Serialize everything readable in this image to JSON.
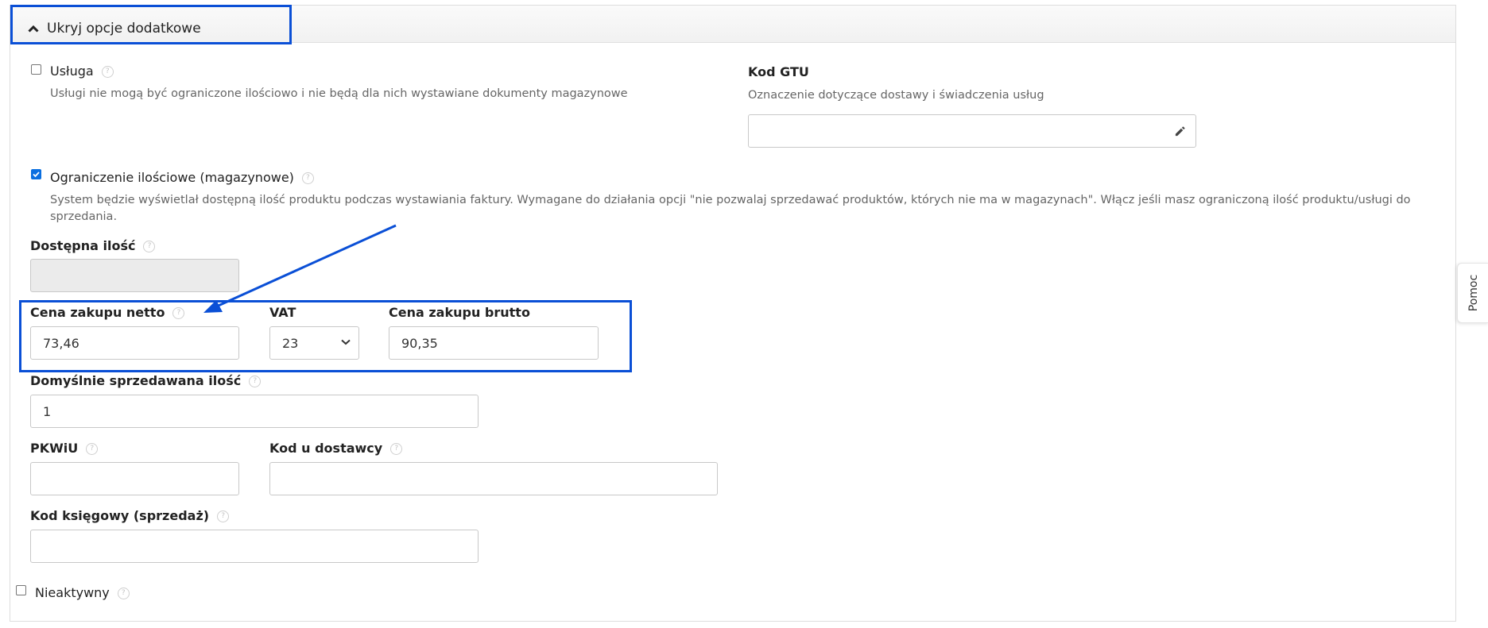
{
  "panel": {
    "toggle_label": "Ukryj opcje dodatkowe"
  },
  "usluga": {
    "label": "Usługa",
    "checked": false,
    "description": "Usługi nie mogą być ograniczone ilościowo i nie będą dla nich wystawiane dokumenty magazynowe"
  },
  "gtu": {
    "label": "Kod GTU",
    "description": "Oznaczenie dotyczące dostawy i świadczenia usług",
    "value": ""
  },
  "ograniczenie": {
    "label": "Ograniczenie ilościowe (magazynowe)",
    "checked": true,
    "description": "System będzie wyświetlał dostępną ilość produktu podczas wystawiania faktury. Wymagane do działania opcji \"nie pozwalaj sprzedawać produktów, których nie ma w magazynach\". Włącz jeśli masz ograniczoną ilość produktu/usługi do sprzedania."
  },
  "dostepna": {
    "label": "Dostępna ilość",
    "value": ""
  },
  "cena_netto": {
    "label": "Cena zakupu netto",
    "value": "73,46"
  },
  "vat": {
    "label": "VAT",
    "value": "23"
  },
  "cena_brutto": {
    "label": "Cena zakupu brutto",
    "value": "90,35"
  },
  "domyslnie": {
    "label": "Domyślnie sprzedawana ilość",
    "value": "1"
  },
  "pkwiu": {
    "label": "PKWiU",
    "value": ""
  },
  "kod_dostawcy": {
    "label": "Kod u dostawcy",
    "value": ""
  },
  "kod_ksiegowy": {
    "label": "Kod księgowy (sprzedaż)",
    "value": ""
  },
  "nieaktywny": {
    "label": "Nieaktywny",
    "checked": false
  },
  "pomoc": {
    "label": "Pomoc"
  },
  "help_icon_glyph": "?",
  "colors": {
    "highlight": "#0a4fd6",
    "checkbox_checked": "#0b6fe0"
  }
}
